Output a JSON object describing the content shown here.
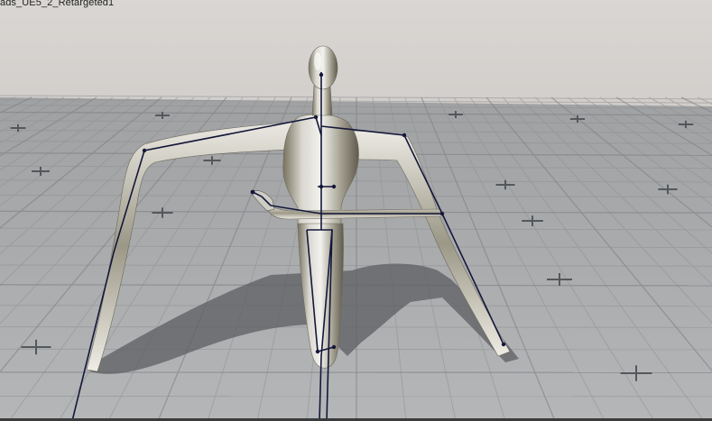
{
  "viewport": {
    "asset_label": "ads_UE5_2_Retargeted1"
  },
  "colors": {
    "sky": "#d8d5d2",
    "floor": "#aeb0b2",
    "grid_line": "#8e9092",
    "grid_cross": "#5b5d60",
    "skeleton": "#14173a",
    "chrome_light": "#e6e4dd",
    "chrome_dark": "#6f6a5e",
    "shadow": "#5c5e61"
  },
  "icons": [
    "bone-joint-icon",
    "grid-cross-marker-icon"
  ]
}
